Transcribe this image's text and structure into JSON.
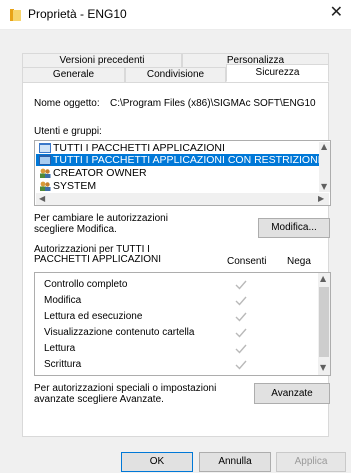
{
  "window": {
    "title": "Proprietà - ENG10",
    "close_glyph": "✕"
  },
  "tabs_row1": [
    "Versioni precedenti",
    "Personalizza"
  ],
  "tabs_row2": [
    "Generale",
    "Condivisione",
    "Sicurezza"
  ],
  "selected_tab": "Sicurezza",
  "object": {
    "label": "Nome oggetto:",
    "value": "C:\\Program Files (x86)\\SIGMAc SOFT\\ENG10"
  },
  "groups": {
    "label": "Utenti e gruppi:",
    "items": [
      {
        "name": "TUTTI I PACCHETTI APPLICAZIONI",
        "icon": "app-package-icon",
        "selected": false
      },
      {
        "name": "TUTTI I PACCHETTI APPLICAZIONI CON RESTRIZIONI",
        "icon": "app-package-icon",
        "selected": true
      },
      {
        "name": "CREATOR OWNER",
        "icon": "users-group-icon",
        "selected": false
      },
      {
        "name": "SYSTEM",
        "icon": "users-group-icon",
        "selected": false
      }
    ]
  },
  "change": {
    "text_line1": "Per cambiare le autorizzazioni",
    "text_line2": "scegliere Modifica.",
    "button": "Modifica..."
  },
  "permissions": {
    "header_line1": "Autorizzazioni per TUTTI I",
    "header_line2": "PACCHETTI APPLICAZIONI",
    "col_allow": "Consenti",
    "col_deny": "Nega",
    "rows": [
      {
        "name": "Controllo completo",
        "allow": true,
        "deny": false
      },
      {
        "name": "Modifica",
        "allow": true,
        "deny": false
      },
      {
        "name": "Lettura ed esecuzione",
        "allow": true,
        "deny": false
      },
      {
        "name": "Visualizzazione contenuto cartella",
        "allow": true,
        "deny": false
      },
      {
        "name": "Lettura",
        "allow": true,
        "deny": false
      },
      {
        "name": "Scrittura",
        "allow": true,
        "deny": false
      }
    ]
  },
  "advanced": {
    "text_line1": "Per autorizzazioni speciali o impostazioni",
    "text_line2": "avanzate scegliere Avanzate.",
    "button": "Avanzate"
  },
  "dialog_buttons": {
    "ok": "OK",
    "cancel": "Annulla",
    "apply": "Applica"
  },
  "colors": {
    "selection": "#0078d7",
    "check_gray": "#b9b9b9"
  }
}
